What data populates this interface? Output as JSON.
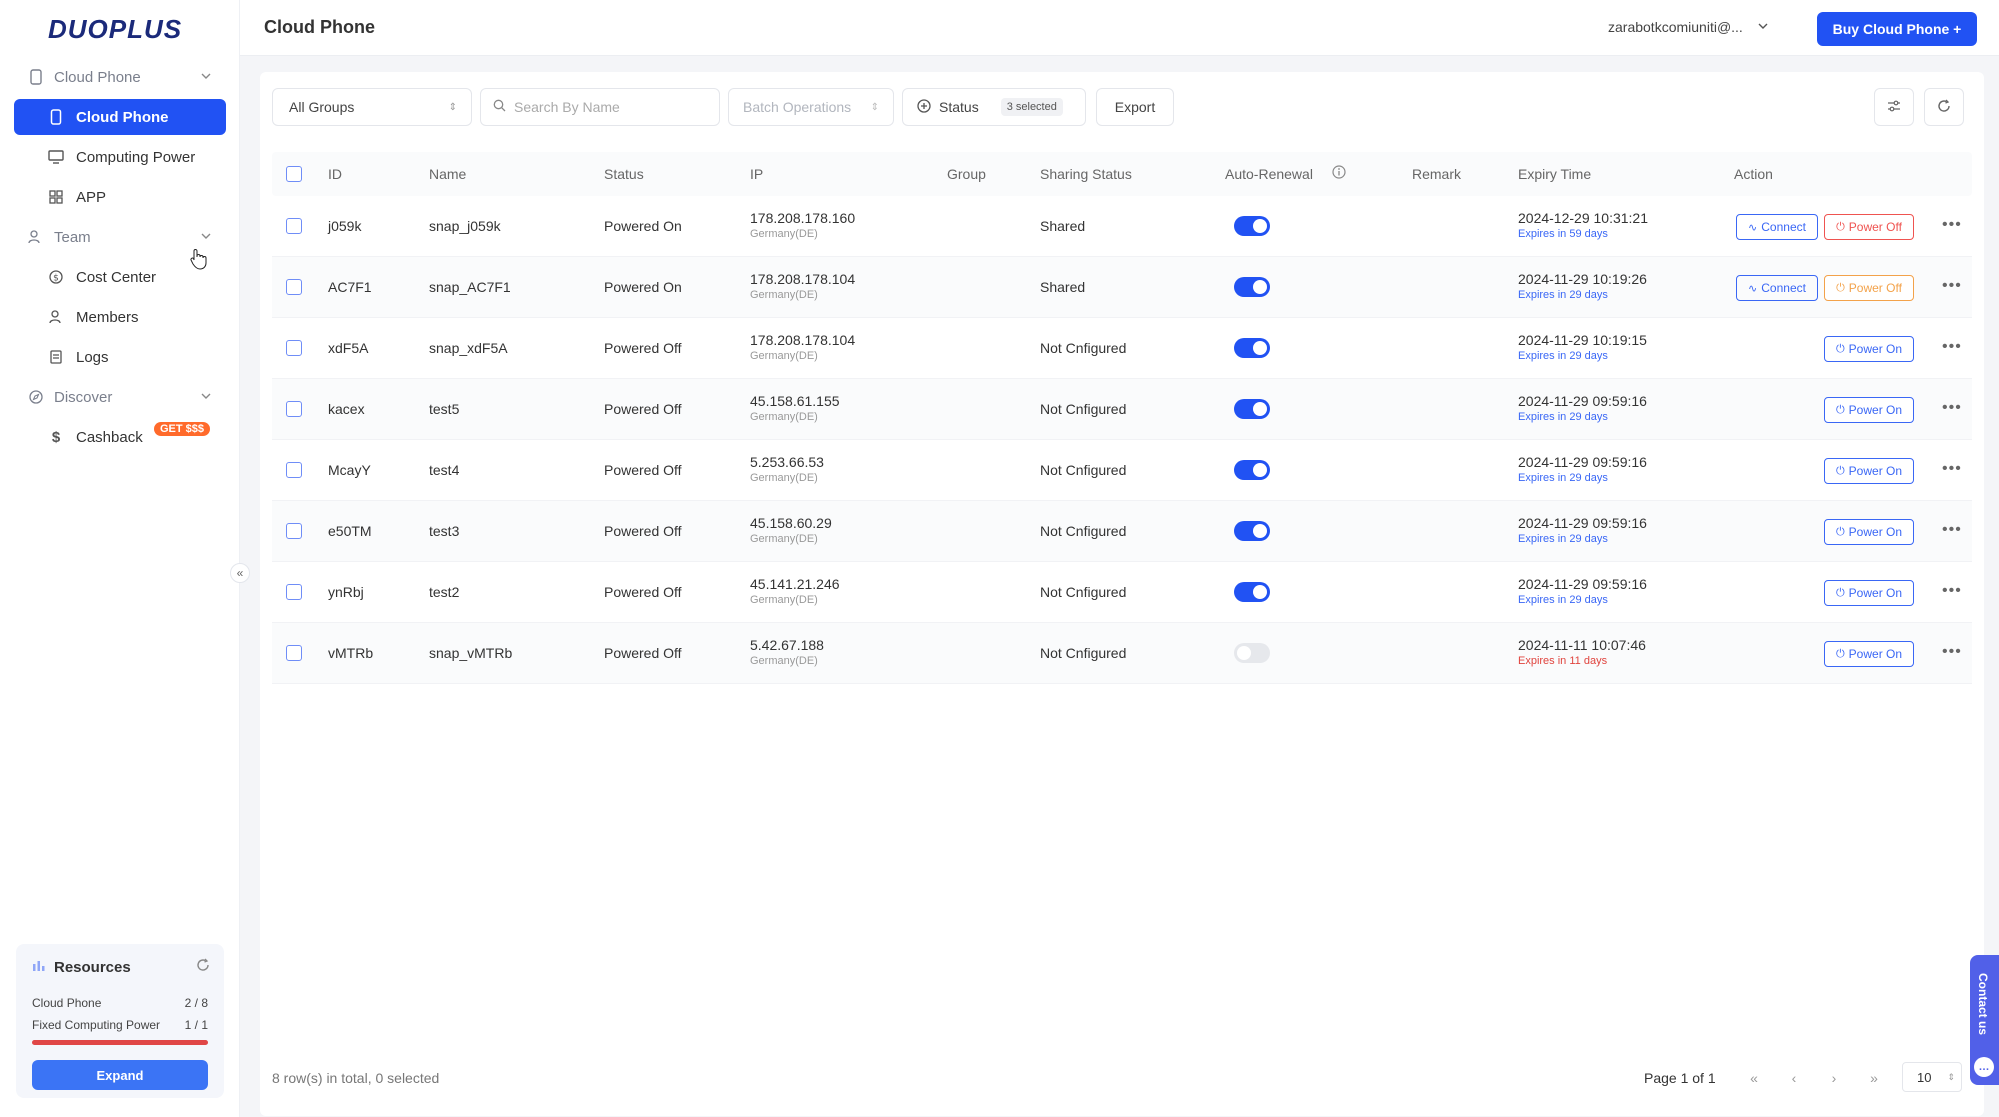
{
  "brand": {
    "logo_text": "DUOPLUS",
    "accent": "#2152f3"
  },
  "sidebar": {
    "groups": [
      {
        "label": "Cloud Phone",
        "icon": "phone-icon"
      },
      {
        "label": "Team",
        "icon": "team-icon"
      },
      {
        "label": "Discover",
        "icon": "discover-icon"
      }
    ],
    "items": [
      {
        "label": "Cloud Phone",
        "icon": "phone-icon",
        "active": true
      },
      {
        "label": "Computing Power",
        "icon": "monitor-icon"
      },
      {
        "label": "APP",
        "icon": "grid-icon"
      },
      {
        "label": "Cost Center",
        "icon": "cost-icon"
      },
      {
        "label": "Members",
        "icon": "members-icon"
      },
      {
        "label": "Logs",
        "icon": "logs-icon"
      },
      {
        "label": "Cashback",
        "icon": "dollar-icon",
        "badge": "GET $$$"
      }
    ]
  },
  "resources": {
    "title": "Resources",
    "cloud_phone_label": "Cloud Phone",
    "cloud_phone_value": "2 / 8",
    "computing_label": "Fixed Computing Power",
    "computing_value": "1 / 1",
    "computing_usage": 1.0,
    "expand_label": "Expand"
  },
  "header": {
    "title": "Cloud Phone",
    "user": "zarabotkcomiuniti@...",
    "buy_label": "Buy Cloud Phone +"
  },
  "toolbar": {
    "groups": "All Groups",
    "search_placeholder": "Search By Name",
    "batch": "Batch Operations",
    "status": "Status",
    "status_selected": "3 selected",
    "export": "Export"
  },
  "table": {
    "columns": [
      "ID",
      "Name",
      "Status",
      "IP",
      "Group",
      "Sharing Status",
      "Auto-Renewal",
      "Remark",
      "Expiry Time",
      "Action"
    ],
    "rows": [
      {
        "id": "j059k",
        "name": "snap_j059k",
        "status": "Powered On",
        "ip": "178.208.178.160",
        "region": "Germany(DE)",
        "sharing": "Shared",
        "auto": true,
        "expiry": "2024-12-29 10:31:21",
        "expires_in": "Expires in 59 days",
        "warn": false,
        "connect": "Connect",
        "power": "Power Off",
        "power_style": "red"
      },
      {
        "id": "AC7F1",
        "name": "snap_AC7F1",
        "status": "Powered On",
        "ip": "178.208.178.104",
        "region": "Germany(DE)",
        "sharing": "Shared",
        "auto": true,
        "expiry": "2024-11-29 10:19:26",
        "expires_in": "Expires in 29 days",
        "warn": false,
        "connect": "Connect",
        "power": "Power Off",
        "power_style": "orange"
      },
      {
        "id": "xdF5A",
        "name": "snap_xdF5A",
        "status": "Powered Off",
        "ip": "178.208.178.104",
        "region": "Germany(DE)",
        "sharing": "Not Cnfigured",
        "auto": true,
        "expiry": "2024-11-29 10:19:15",
        "expires_in": "Expires in 29 days",
        "warn": false,
        "power": "Power On",
        "power_style": "blue"
      },
      {
        "id": "kacex",
        "name": "test5",
        "status": "Powered Off",
        "ip": "45.158.61.155",
        "region": "Germany(DE)",
        "sharing": "Not Cnfigured",
        "auto": true,
        "expiry": "2024-11-29 09:59:16",
        "expires_in": "Expires in 29 days",
        "warn": false,
        "power": "Power On",
        "power_style": "blue"
      },
      {
        "id": "McayY",
        "name": "test4",
        "status": "Powered Off",
        "ip": "5.253.66.53",
        "region": "Germany(DE)",
        "sharing": "Not Cnfigured",
        "auto": true,
        "expiry": "2024-11-29 09:59:16",
        "expires_in": "Expires in 29 days",
        "warn": false,
        "power": "Power On",
        "power_style": "blue"
      },
      {
        "id": "e50TM",
        "name": "test3",
        "status": "Powered Off",
        "ip": "45.158.60.29",
        "region": "Germany(DE)",
        "sharing": "Not Cnfigured",
        "auto": true,
        "expiry": "2024-11-29 09:59:16",
        "expires_in": "Expires in 29 days",
        "warn": false,
        "power": "Power On",
        "power_style": "blue"
      },
      {
        "id": "ynRbj",
        "name": "test2",
        "status": "Powered Off",
        "ip": "45.141.21.246",
        "region": "Germany(DE)",
        "sharing": "Not Cnfigured",
        "auto": true,
        "expiry": "2024-11-29 09:59:16",
        "expires_in": "Expires in 29 days",
        "warn": false,
        "power": "Power On",
        "power_style": "blue"
      },
      {
        "id": "vMTRb",
        "name": "snap_vMTRb",
        "status": "Powered Off",
        "ip": "5.42.67.188",
        "region": "Germany(DE)",
        "sharing": "Not Cnfigured",
        "auto": false,
        "expiry": "2024-11-11 10:07:46",
        "expires_in": "Expires in 11 days",
        "warn": true,
        "power": "Power On",
        "power_style": "blue"
      }
    ]
  },
  "footer": {
    "total": "8 row(s) in total, 0 selected",
    "page": "Page 1 of 1",
    "page_size": "10"
  },
  "contact": {
    "label": "Contact us"
  }
}
